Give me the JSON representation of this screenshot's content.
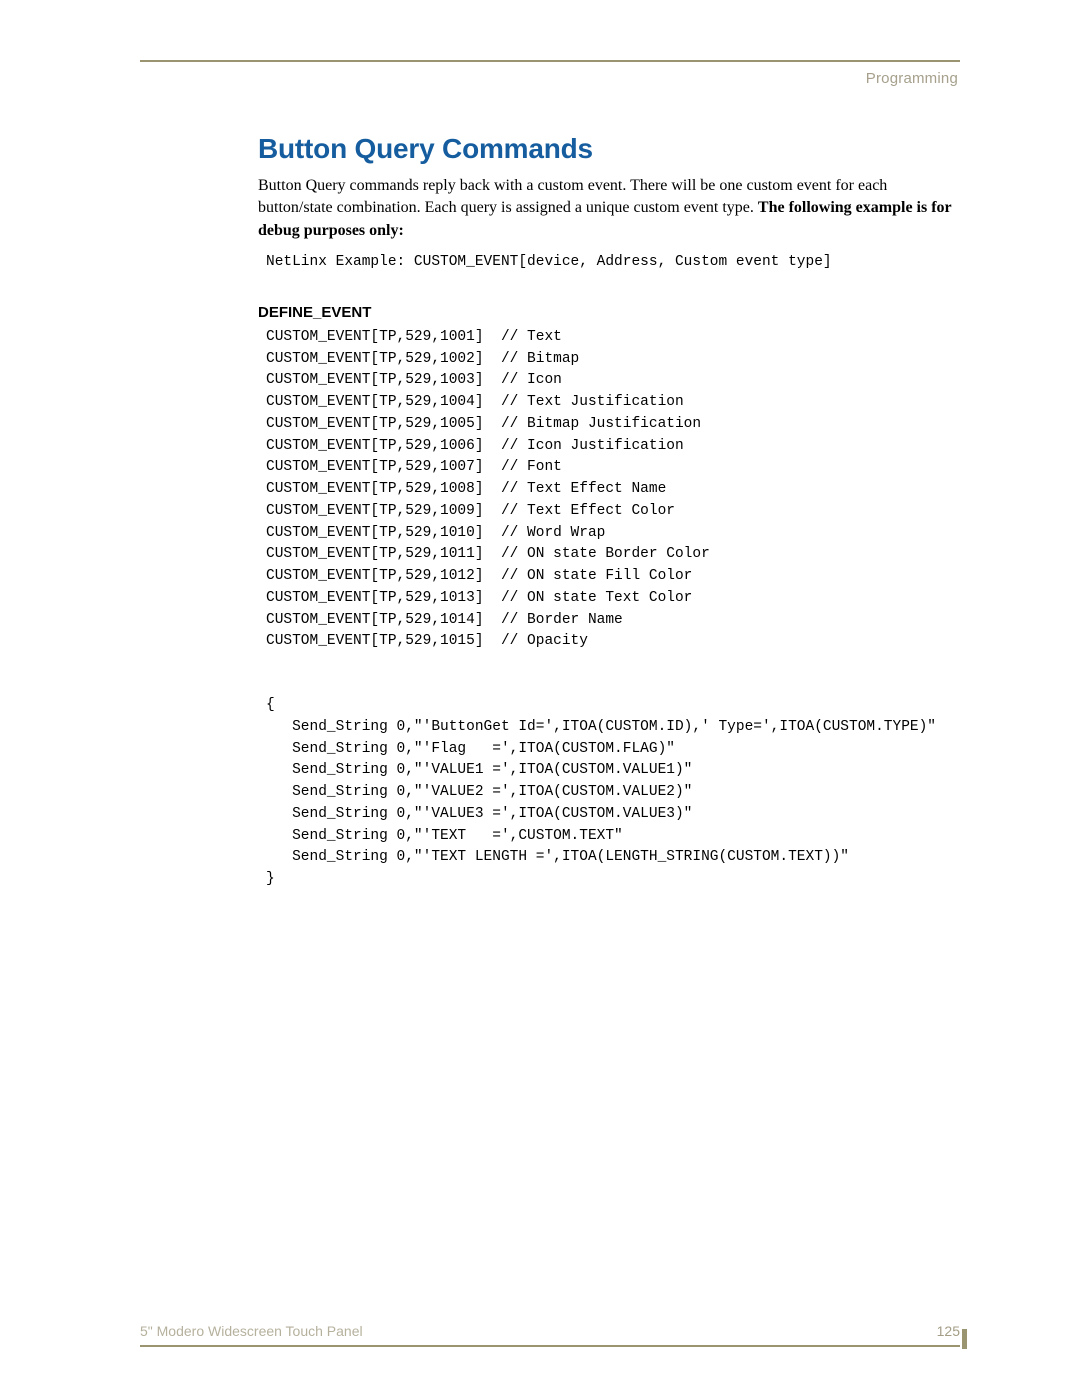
{
  "header": {
    "section": "Programming"
  },
  "title": "Button Query Commands",
  "intro": {
    "text1": "Button Query commands reply back with a custom event. There will be one custom event for each button/state combination. Each query is assigned a unique custom event type. ",
    "bold": "The following example is for debug purposes only:"
  },
  "netlinx_line": "NetLinx Example: CUSTOM_EVENT[device, Address, Custom event type]",
  "define_heading": "DEFINE_EVENT",
  "events": [
    {
      "code": "CUSTOM_EVENT[TP,529,1001]",
      "comment": "// Text"
    },
    {
      "code": "CUSTOM_EVENT[TP,529,1002]",
      "comment": "// Bitmap"
    },
    {
      "code": "CUSTOM_EVENT[TP,529,1003]",
      "comment": "// Icon"
    },
    {
      "code": "CUSTOM_EVENT[TP,529,1004]",
      "comment": "// Text Justification"
    },
    {
      "code": "CUSTOM_EVENT[TP,529,1005]",
      "comment": "// Bitmap Justification"
    },
    {
      "code": "CUSTOM_EVENT[TP,529,1006]",
      "comment": "// Icon Justification"
    },
    {
      "code": "CUSTOM_EVENT[TP,529,1007]",
      "comment": "// Font"
    },
    {
      "code": "CUSTOM_EVENT[TP,529,1008]",
      "comment": "// Text Effect Name"
    },
    {
      "code": "CUSTOM_EVENT[TP,529,1009]",
      "comment": "// Text Effect Color"
    },
    {
      "code": "CUSTOM_EVENT[TP,529,1010]",
      "comment": "// Word Wrap"
    },
    {
      "code": "CUSTOM_EVENT[TP,529,1011]",
      "comment": "// ON state Border Color"
    },
    {
      "code": "CUSTOM_EVENT[TP,529,1012]",
      "comment": "// ON state Fill Color"
    },
    {
      "code": "CUSTOM_EVENT[TP,529,1013]",
      "comment": "// ON state Text Color"
    },
    {
      "code": "CUSTOM_EVENT[TP,529,1014]",
      "comment": "// Border Name"
    },
    {
      "code": "CUSTOM_EVENT[TP,529,1015]",
      "comment": "// Opacity"
    }
  ],
  "block": [
    "{",
    "   Send_String 0,\"'ButtonGet Id=',ITOA(CUSTOM.ID),' Type=',ITOA(CUSTOM.TYPE)\"",
    "   Send_String 0,\"'Flag   =',ITOA(CUSTOM.FLAG)\"",
    "   Send_String 0,\"'VALUE1 =',ITOA(CUSTOM.VALUE1)\"",
    "   Send_String 0,\"'VALUE2 =',ITOA(CUSTOM.VALUE2)\"",
    "   Send_String 0,\"'VALUE3 =',ITOA(CUSTOM.VALUE3)\"",
    "   Send_String 0,\"'TEXT   =',CUSTOM.TEXT\"",
    "   Send_String 0,\"'TEXT LENGTH =',ITOA(LENGTH_STRING(CUSTOM.TEXT))\"",
    "}"
  ],
  "footer": {
    "left": "5\" Modero Widescreen Touch Panel",
    "page": "125"
  }
}
